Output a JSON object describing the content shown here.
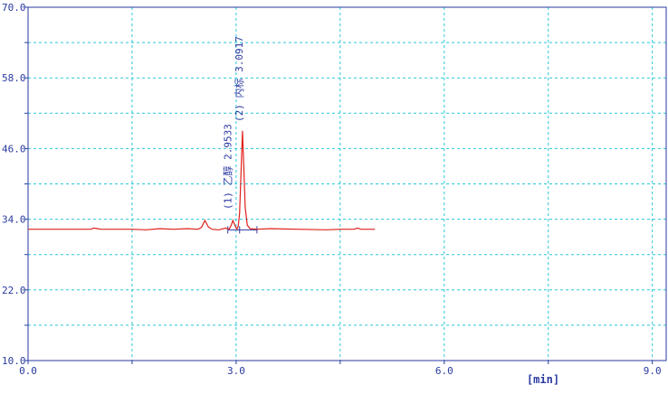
{
  "chart_data": {
    "type": "line",
    "xlabel": "[min]",
    "x_ticks": [
      "0.0",
      "3.0",
      "6.0",
      "9.0"
    ],
    "y_ticks": [
      "10.0",
      "22.0",
      "34.0",
      "46.0",
      "58.0",
      "70.0"
    ],
    "xlim": [
      0.0,
      9.2
    ],
    "ylim": [
      10.0,
      70.0
    ],
    "grid": true,
    "series": [
      {
        "color": "#e0201c",
        "x": [
          0.0,
          0.9,
          0.95,
          1.0,
          1.05,
          1.5,
          1.7,
          1.9,
          2.1,
          2.3,
          2.45,
          2.5,
          2.55,
          2.6,
          2.65,
          2.75,
          2.85,
          2.9,
          2.93,
          2.9533,
          2.98,
          3.01,
          3.03,
          3.05,
          3.07,
          3.0917,
          3.11,
          3.13,
          3.16,
          3.2,
          3.3,
          3.5,
          3.9,
          4.3,
          4.5,
          4.7,
          4.75,
          4.8,
          5.0
        ],
        "y": [
          32.3,
          32.3,
          32.5,
          32.4,
          32.3,
          32.3,
          32.2,
          32.4,
          32.3,
          32.4,
          32.3,
          32.6,
          33.8,
          32.7,
          32.3,
          32.2,
          32.5,
          32.3,
          33.0,
          33.8,
          33.0,
          32.3,
          32.8,
          35.0,
          42.0,
          49.0,
          43.0,
          36.0,
          33.0,
          32.4,
          32.3,
          32.4,
          32.3,
          32.2,
          32.3,
          32.3,
          32.5,
          32.3,
          32.3
        ]
      }
    ],
    "peaks": [
      {
        "x": 2.9533,
        "label": "(1) 乙醇 2.9533"
      },
      {
        "x": 3.0917,
        "label": "(2) 内标 3.0917"
      }
    ],
    "integration_marks": [
      2.88,
      3.05,
      3.3
    ]
  },
  "colors": {
    "grid": "#28c8d8",
    "axis": "#2a3aa0",
    "trace": "#e0201c",
    "baseline": "#2a3aa0"
  }
}
